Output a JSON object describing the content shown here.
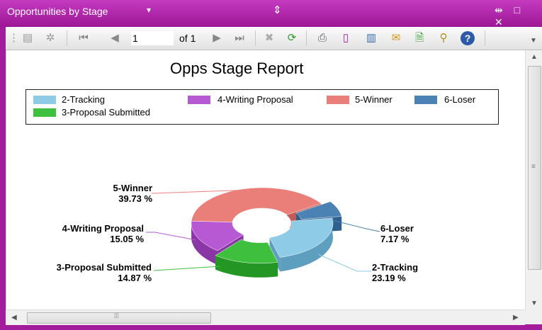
{
  "window": {
    "title": "Opportunities by Stage",
    "title_caret": "▾",
    "center_icon": "⇕",
    "actions": "⇹ □ ✕"
  },
  "toolbar": {
    "page_value": "1",
    "page_of": "of 1"
  },
  "chart_data": {
    "type": "pie",
    "title": "Opps Stage Report",
    "legend_position": "top",
    "categories": [
      "2-Tracking",
      "3-Proposal Submitted",
      "4-Writing Proposal",
      "5-Winner",
      "6-Loser"
    ],
    "values": [
      23.19,
      14.87,
      15.05,
      39.73,
      7.17
    ],
    "labels": [
      "2-Tracking",
      "3-Proposal Submitted",
      "4-Writing Proposal",
      "5-Winner",
      "6-Loser"
    ],
    "percent_labels": [
      "23.19 %",
      "14.87 %",
      "15.05 %",
      "39.73 %",
      "7.17 %"
    ],
    "colors": [
      "#8ecbe6",
      "#3ec03e",
      "#b659d2",
      "#ea7f7a",
      "#4a82b4"
    ],
    "side_colors": [
      "#5e9ebf",
      "#239623",
      "#8a36a6",
      "#c25c58",
      "#2f5f8d"
    ],
    "style": "3D doughnut"
  }
}
